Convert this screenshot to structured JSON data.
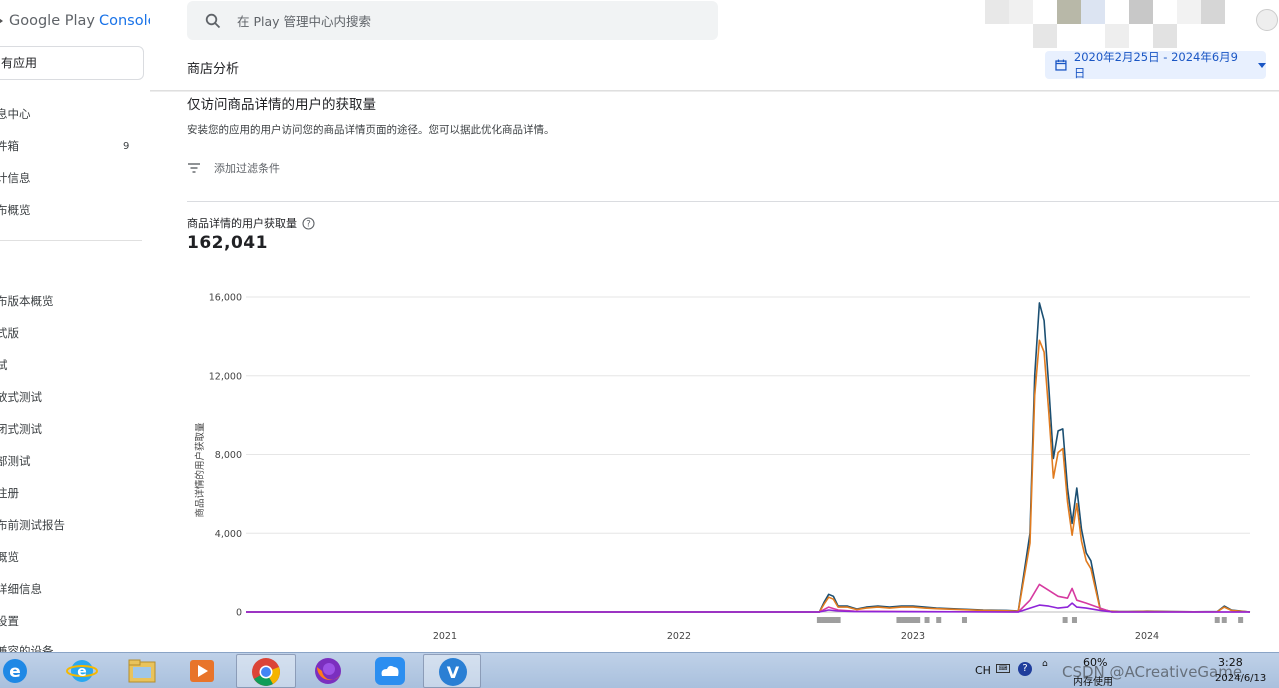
{
  "sidebar": {
    "logo": {
      "google_play": "Google Play",
      "console": "Console"
    },
    "app_selector": "有应用",
    "items_top": [
      {
        "label": "息中心"
      },
      {
        "label": "件箱",
        "count": "9"
      },
      {
        "label": "计信息"
      },
      {
        "label": "布概览"
      }
    ],
    "items_bottom": [
      {
        "label": "布版本概览"
      },
      {
        "label": "式版"
      },
      {
        "label": "试"
      },
      {
        "label": "放式测试"
      },
      {
        "label": "闭式测试"
      },
      {
        "label": "部测试"
      },
      {
        "label": "注册"
      },
      {
        "label": "布前测试报告"
      },
      {
        "label": "概览"
      },
      {
        "label": "详细信息"
      },
      {
        "label": "设置"
      },
      {
        "label": "兼容的设备"
      }
    ]
  },
  "search": {
    "placeholder": "在 Play 管理中心内搜索"
  },
  "header": {
    "title": "商店分析",
    "date_range": "2020年2月25日 - 2024年6月9日"
  },
  "section": {
    "title": "仅访问商品详情的用户的获取量",
    "description": "安装您的应用的用户访问您的商品详情页面的途径。您可以据此优化商品详情。",
    "filter_label": "添加过滤条件"
  },
  "metric": {
    "label": "商品详情的用户获取量",
    "value": "162,041"
  },
  "chart_data": {
    "type": "line",
    "ylabel": "商品详情的用户获取量",
    "ylim": [
      0,
      16000
    ],
    "yticks": [
      "16,000",
      "12,000",
      "8,000",
      "4,000",
      "0"
    ],
    "xticks": [
      {
        "label": "2021",
        "year": 2021.0
      },
      {
        "label": "2022",
        "year": 2022.0
      },
      {
        "label": "2023",
        "year": 2023.0
      },
      {
        "label": "2024",
        "year": 2024.0
      }
    ],
    "xlim": [
      2020.15,
      2024.44
    ],
    "grid": true,
    "colors": {
      "navy": "#1b4f72",
      "orange": "#e07b1f",
      "pink": "#d63aa0",
      "purple": "#8e24d8"
    },
    "series": [
      {
        "color_key": "navy",
        "x": [
          2020.15,
          2022.6,
          2022.62,
          2022.64,
          2022.66,
          2022.68,
          2022.72,
          2022.76,
          2022.8,
          2022.85,
          2022.9,
          2022.95,
          2023.0,
          2023.05,
          2023.1,
          2023.2,
          2023.3,
          2023.4,
          2023.45,
          2023.5,
          2023.52,
          2023.54,
          2023.56,
          2023.58,
          2023.6,
          2023.62,
          2023.64,
          2023.66,
          2023.68,
          2023.7,
          2023.72,
          2023.74,
          2023.76,
          2023.8,
          2023.84,
          2023.88,
          2023.92,
          2024.0,
          2024.1,
          2024.2,
          2024.3,
          2024.33,
          2024.36,
          2024.44
        ],
        "y": [
          0,
          0,
          500,
          900,
          800,
          300,
          300,
          150,
          250,
          300,
          250,
          300,
          300,
          250,
          200,
          150,
          100,
          80,
          50,
          4000,
          12000,
          15700,
          14800,
          11500,
          7800,
          9200,
          9300,
          6300,
          4500,
          6300,
          4200,
          3000,
          2600,
          150,
          50,
          20,
          20,
          40,
          20,
          10,
          20,
          300,
          100,
          0
        ]
      },
      {
        "color_key": "orange",
        "x": [
          2020.15,
          2022.6,
          2022.62,
          2022.64,
          2022.66,
          2022.68,
          2022.72,
          2022.76,
          2022.8,
          2022.85,
          2022.9,
          2022.95,
          2023.0,
          2023.05,
          2023.1,
          2023.2,
          2023.3,
          2023.4,
          2023.45,
          2023.5,
          2023.52,
          2023.54,
          2023.56,
          2023.58,
          2023.6,
          2023.62,
          2023.64,
          2023.66,
          2023.68,
          2023.7,
          2023.72,
          2023.74,
          2023.76,
          2023.8,
          2023.84,
          2023.88,
          2023.92,
          2024.0,
          2024.1,
          2024.2,
          2024.3,
          2024.33,
          2024.36,
          2024.44
        ],
        "y": [
          0,
          0,
          400,
          750,
          650,
          250,
          250,
          120,
          200,
          250,
          200,
          250,
          250,
          200,
          170,
          120,
          80,
          60,
          40,
          3500,
          11000,
          13800,
          13200,
          10200,
          6800,
          8100,
          8300,
          5600,
          3900,
          5500,
          3600,
          2600,
          2200,
          120,
          40,
          15,
          15,
          30,
          15,
          8,
          15,
          250,
          80,
          0
        ]
      },
      {
        "color_key": "pink",
        "x": [
          2020.15,
          2022.6,
          2022.64,
          2022.68,
          2022.75,
          2023.45,
          2023.5,
          2023.54,
          2023.58,
          2023.62,
          2023.66,
          2023.68,
          2023.7,
          2023.74,
          2023.8,
          2023.85,
          2024.44
        ],
        "y": [
          0,
          0,
          250,
          100,
          40,
          0,
          600,
          1400,
          1100,
          800,
          700,
          1200,
          600,
          450,
          200,
          0,
          0
        ]
      },
      {
        "color_key": "purple",
        "x": [
          2020.15,
          2022.6,
          2022.64,
          2022.68,
          2022.75,
          2023.45,
          2023.5,
          2023.54,
          2023.58,
          2023.62,
          2023.66,
          2023.68,
          2023.7,
          2023.74,
          2023.8,
          2023.85,
          2024.44
        ],
        "y": [
          0,
          0,
          100,
          50,
          20,
          0,
          200,
          350,
          300,
          200,
          250,
          450,
          250,
          200,
          80,
          0,
          0
        ]
      }
    ],
    "annotation_marker_years": [
      2022.6,
      2022.62,
      2022.64,
      2022.66,
      2022.68,
      2022.94,
      2022.96,
      2022.98,
      2023.0,
      2023.02,
      2023.06,
      2023.11,
      2023.22,
      2023.65,
      2023.69,
      2024.3,
      2024.33,
      2024.4
    ]
  },
  "taskbar": {
    "tray": {
      "language": "CH",
      "memory_percent": "60%",
      "memory_label": "内存使用",
      "time": "3:28",
      "date": "2024/6/13",
      "watermark": "CSDN @ACreativeGame"
    }
  }
}
